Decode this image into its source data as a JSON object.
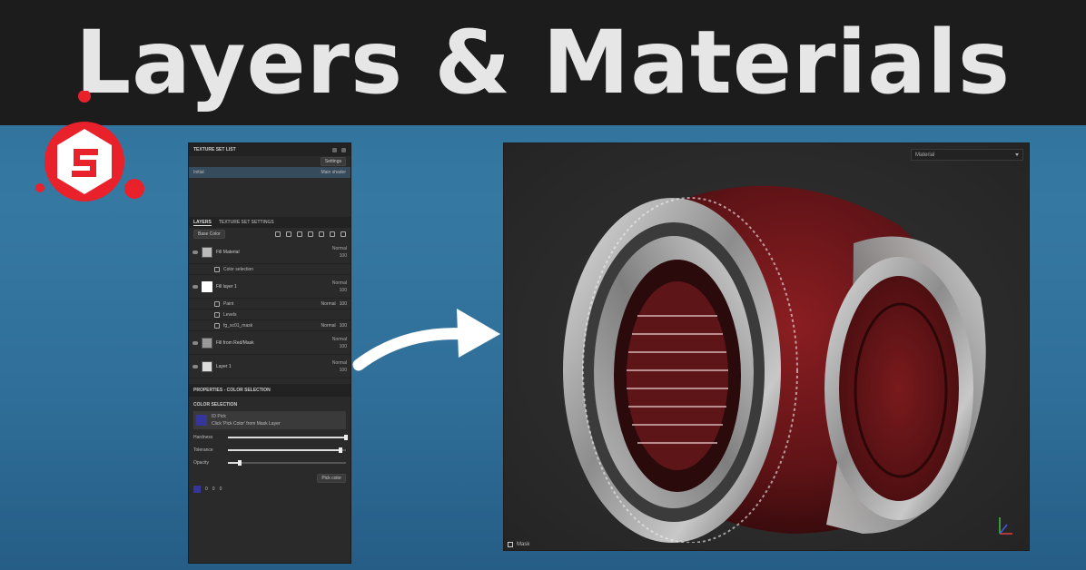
{
  "title": "Layers & Materials",
  "colors": {
    "title_bar": "#1c1c1c",
    "title_text": "#e6e6e6",
    "background": "#2f6e98",
    "logo_red": "#e8212b",
    "material_red": "#6e1618",
    "metal": "#a9a9a9"
  },
  "logo": {
    "icon": "substance-painter-logo"
  },
  "panel": {
    "texture_set_list": {
      "header": "TEXTURE SET LIST",
      "settings_label": "Settings",
      "item": "Initial",
      "item_shader": "Main shader"
    },
    "layers": {
      "tab_layers": "LAYERS",
      "tab_settings": "TEXTURE SET SETTINGS",
      "channel_select": "Base Color",
      "items": [
        {
          "name": "Fill Material",
          "blend": "Normal",
          "opacity": "100"
        },
        {
          "name": "Fill layer 1",
          "blend": "Normal",
          "opacity": "100"
        },
        {
          "name": "Fill from Red/Mask",
          "blend": "Normal",
          "opacity": "100"
        },
        {
          "name": "Layer 1",
          "blend": "Normal",
          "opacity": "100"
        }
      ],
      "sub_items": [
        {
          "name": "Color selection"
        },
        {
          "name": "Paint",
          "blend": "Normal",
          "opacity": "100"
        },
        {
          "name": "Levels"
        },
        {
          "name": "fg_sc01_mask",
          "blend": "Normal",
          "opacity": "100"
        }
      ]
    },
    "properties": {
      "header": "PROPERTIES - COLOR SELECTION",
      "section": "COLOR SELECTION",
      "id_map_name": "ID Pick",
      "id_map_desc": "Click 'Pick Color' from Mask Layer",
      "sliders": [
        {
          "label": "Hardness",
          "value": 1
        },
        {
          "label": "Tolerance",
          "value": 0.95
        },
        {
          "label": "Opacity",
          "value": 0.1
        }
      ],
      "pick_color_button": "Pick color",
      "footer_values": [
        "0",
        "0",
        "0"
      ]
    }
  },
  "viewport": {
    "mode_select": "Material",
    "footer_label": "Mask"
  }
}
